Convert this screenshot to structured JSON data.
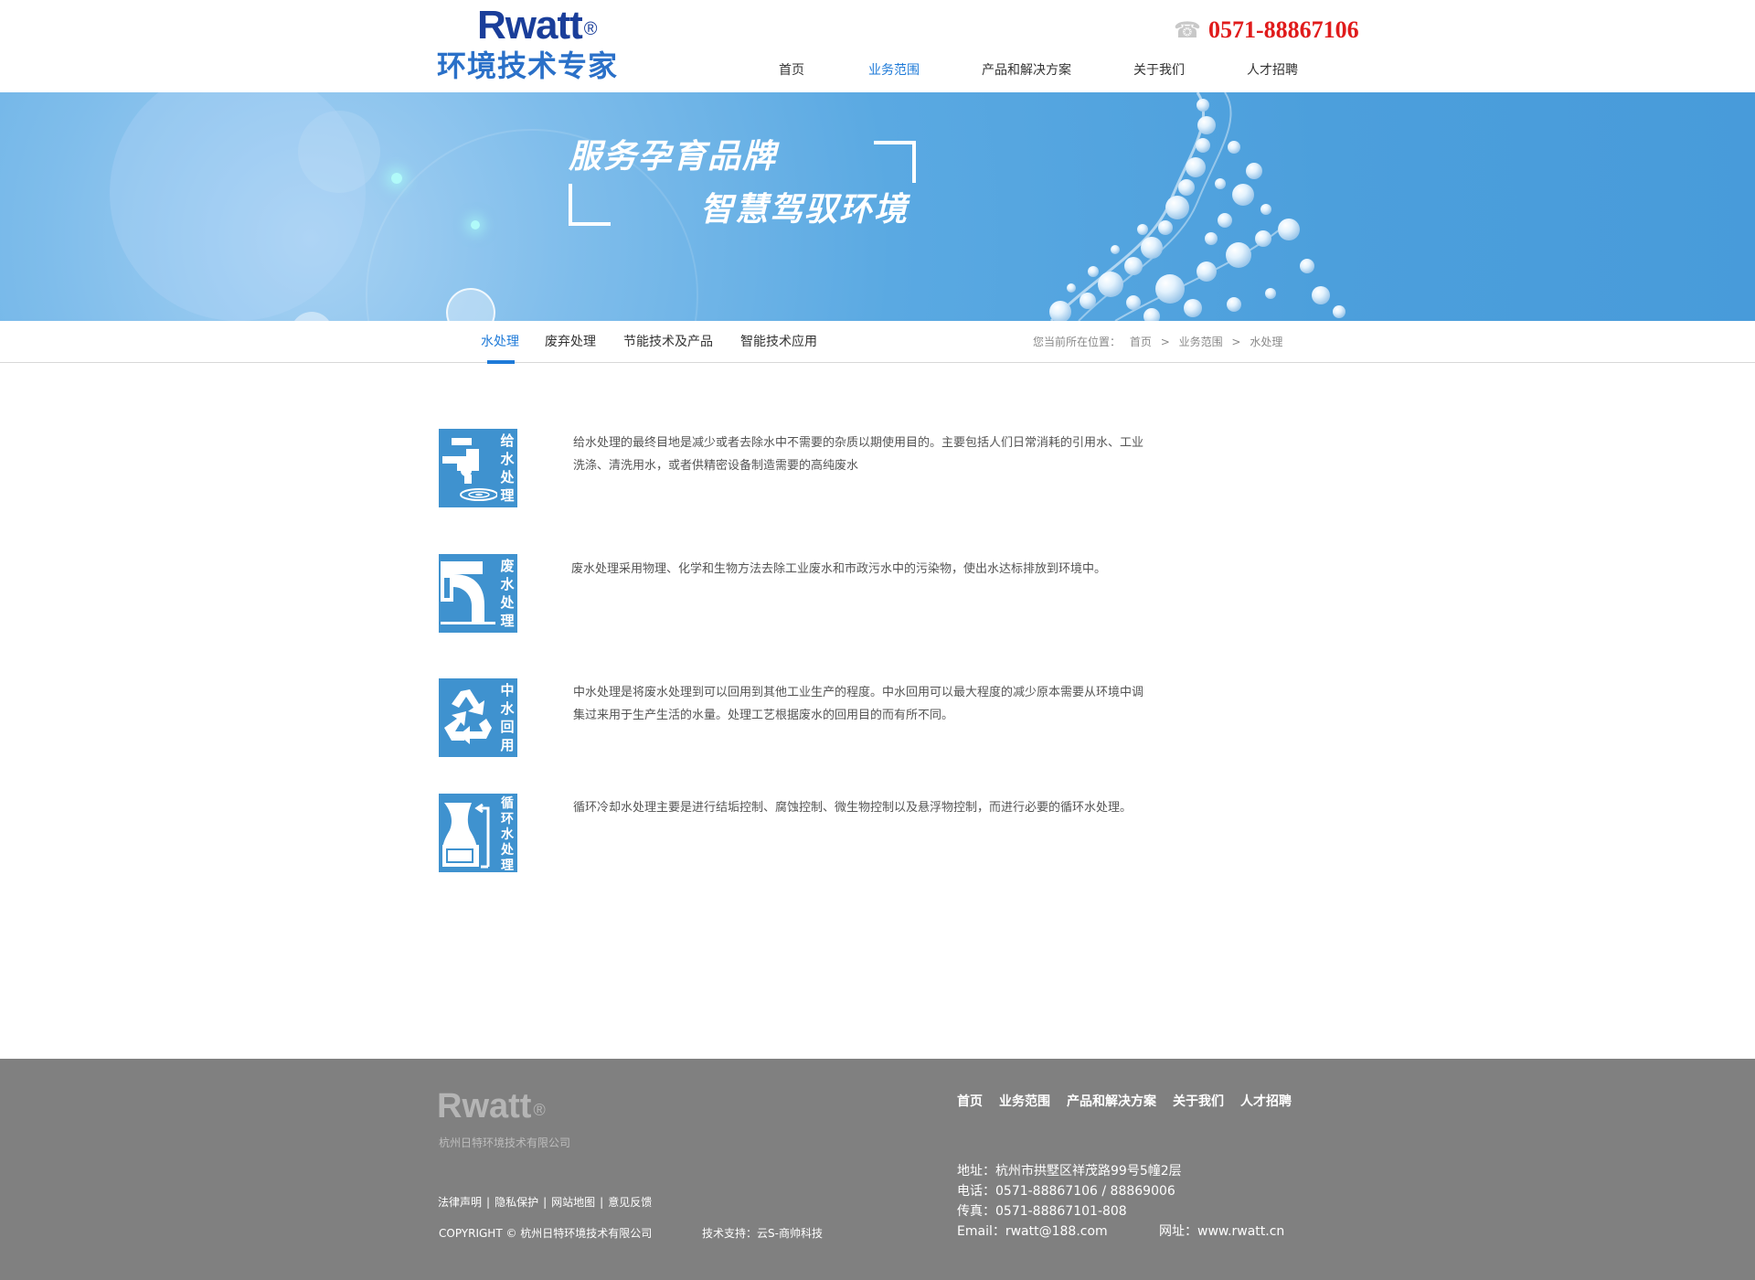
{
  "header": {
    "logo_text": "Rwatt",
    "logo_mark": "®",
    "slogan": "环境技术专家",
    "phone_icon": "phone-icon",
    "phone": "0571-88867106",
    "nav": [
      "首页",
      "业务范围",
      "产品和解决方案",
      "关于我们",
      "人才招聘"
    ],
    "nav_active": "业务范围"
  },
  "banner": {
    "title_line1": "服务孕育品牌",
    "title_line2": "智慧驾驭环境"
  },
  "subnav": {
    "tabs": [
      "水处理",
      "废弃处理",
      "节能技术及产品",
      "智能技术应用"
    ],
    "active": "水处理",
    "breadcrumb_label": "您当前所在位置：",
    "breadcrumb": [
      "首页",
      ">",
      "业务范围",
      ">",
      "水处理"
    ]
  },
  "services": [
    {
      "icon": "faucet-icon",
      "label": "给水处理",
      "text": "给水处理的最终目地是减少或者去除水中不需要的杂质以期使用目的。主要包括人们日常消耗的引用水、工业洗涤、清洗用水，或者供精密设备制造需要的高纯废水"
    },
    {
      "icon": "pipe-icon",
      "label": "废水处理",
      "text": "废水处理采用物理、化学和生物方法去除工业废水和市政污水中的污染物，使出水达标排放到环境中。"
    },
    {
      "icon": "recycle-icon",
      "label": "中水回用",
      "text": "中水处理是将废水处理到可以回用到其他工业生产的程度。中水回用可以最大程度的减少原本需要从环境中调集过来用于生产生活的水量。处理工艺根据废水的回用目的而有所不同。"
    },
    {
      "icon": "cooling-tower-icon",
      "label": "循环水处理",
      "text": "循环冷却水处理主要是进行结垢控制、腐蚀控制、微生物控制以及悬浮物控制，而进行必要的循环水处理。"
    }
  ],
  "footer": {
    "logo_text": "Rwatt",
    "logo_mark": "®",
    "company": "杭州日特环境技术有限公司",
    "links": [
      "法律声明",
      "隐私保护",
      "网站地图",
      "意见反馈"
    ],
    "link_sep": "|",
    "copyright": "COPYRIGHT © 杭州日特环境技术有限公司",
    "support": "技术支持：云S-商帅科技",
    "nav": [
      "首页",
      "业务范围",
      "产品和解决方案",
      "关于我们",
      "人才招聘"
    ],
    "address": "地址：杭州市拱墅区祥茂路99号5幢2层",
    "tel": "电话：0571-88867106 / 88869006",
    "fax": "传真：0571-88867101-808",
    "email": "Email：rwatt@188.com",
    "website": "网址：www.rwatt.cn"
  },
  "colors": {
    "accent": "#1e7ad8",
    "icon_bg": "#3f92cf",
    "phone": "#e01b1b",
    "footer_bg": "#808080",
    "banner": "#4c9fdc"
  }
}
